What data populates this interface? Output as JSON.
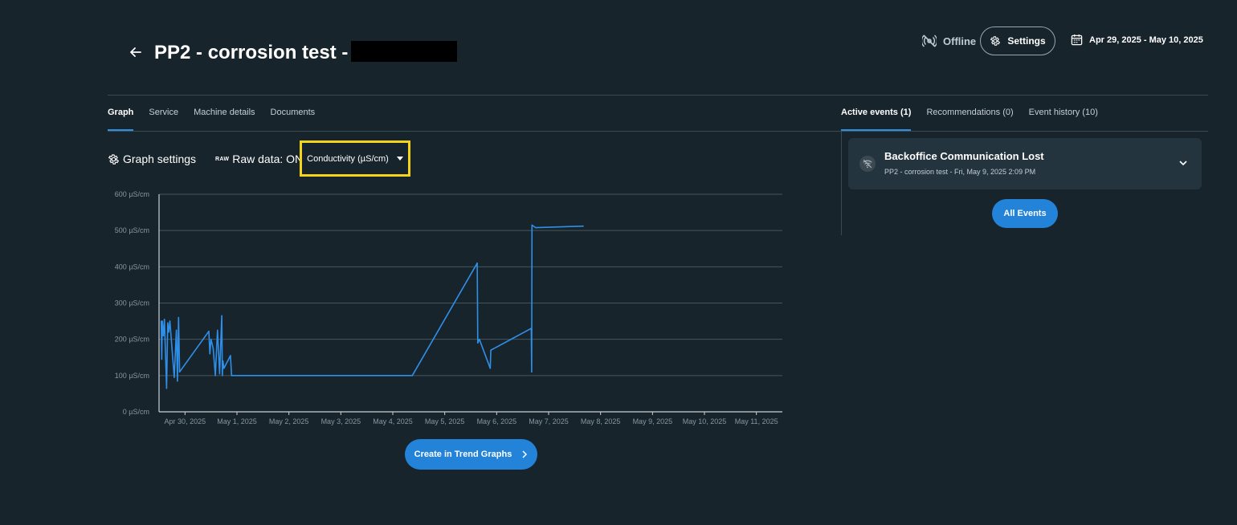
{
  "header": {
    "title": "PP2 - corrosion test -",
    "status": "Offline",
    "settings_label": "Settings",
    "date_range": "Apr 29, 2025 - May 10, 2025"
  },
  "tabs_left": [
    {
      "label": "Graph",
      "active": true
    },
    {
      "label": "Service",
      "active": false
    },
    {
      "label": "Machine details",
      "active": false
    },
    {
      "label": "Documents",
      "active": false
    }
  ],
  "tabs_right": [
    {
      "label": "Active events (1)",
      "active": true
    },
    {
      "label": "Recommendations (0)",
      "active": false
    },
    {
      "label": "Event history (10)",
      "active": false
    }
  ],
  "graph_controls": {
    "graph_settings_label": "Graph settings",
    "raw_tag": "RAW",
    "raw_data_label": "Raw data: ON",
    "parameter_selected": "Conductivity (µS/cm)"
  },
  "chart_data": {
    "type": "line",
    "y_ticks": [
      "0 µS/cm",
      "100 µS/cm",
      "200 µS/cm",
      "300 µS/cm",
      "400 µS/cm",
      "500 µS/cm",
      "600 µS/cm"
    ],
    "x_ticks": [
      "Apr 30, 2025",
      "May 1, 2025",
      "May 2, 2025",
      "May 3, 2025",
      "May 4, 2025",
      "May 5, 2025",
      "May 6, 2025",
      "May 7, 2025",
      "May 8, 2025",
      "May 9, 2025",
      "May 10, 2025",
      "May 11, 2025"
    ],
    "ylim": [
      0,
      600
    ],
    "xlim": [
      "2025-04-29T12:00",
      "2025-05-11T12:00"
    ],
    "grid": true,
    "color": "#2f8fe8",
    "series": [
      {
        "x": [
          "2025-04-29T13:00",
          "2025-04-29T13:15",
          "2025-04-29T13:30",
          "2025-04-29T14:00",
          "2025-04-29T14:30",
          "2025-04-29T15:30",
          "2025-04-29T16:00",
          "2025-04-29T16:30",
          "2025-04-29T17:00",
          "2025-04-29T19:00",
          "2025-04-29T20:00",
          "2025-04-29T20:30",
          "2025-04-29T21:00",
          "2025-04-29T21:30",
          "2025-04-30T11:00",
          "2025-04-30T11:30",
          "2025-04-30T12:00",
          "2025-04-30T13:00",
          "2025-04-30T14:00",
          "2025-04-30T15:00",
          "2025-04-30T16:00",
          "2025-04-30T17:00",
          "2025-04-30T17:15",
          "2025-04-30T17:30",
          "2025-04-30T18:00",
          "2025-04-30T21:00",
          "2025-04-30T21:30",
          "2025-05-04T09:00",
          "2025-05-05T15:00",
          "2025-05-05T15:15",
          "2025-05-05T16:00",
          "2025-05-05T21:00",
          "2025-05-05T21:20",
          "2025-05-06T16:00",
          "2025-05-06T16:10",
          "2025-05-06T16:20",
          "2025-05-06T18:00",
          "2025-05-07T16:00"
        ],
        "values": [
          250,
          145,
          250,
          210,
          255,
          65,
          245,
          220,
          250,
          95,
          225,
          85,
          260,
          110,
          222,
          160,
          200,
          175,
          100,
          225,
          105,
          265,
          100,
          140,
          120,
          155,
          100,
          100,
          410,
          190,
          200,
          120,
          170,
          230,
          110,
          515,
          508,
          512
        ]
      }
    ]
  },
  "trend_button_label": "Create in Trend Graphs",
  "event": {
    "title": "Backoffice Communication Lost",
    "subtitle": "PP2 - corrosion test - Fri, May 9, 2025 2:09 PM"
  },
  "all_events_label": "All Events"
}
